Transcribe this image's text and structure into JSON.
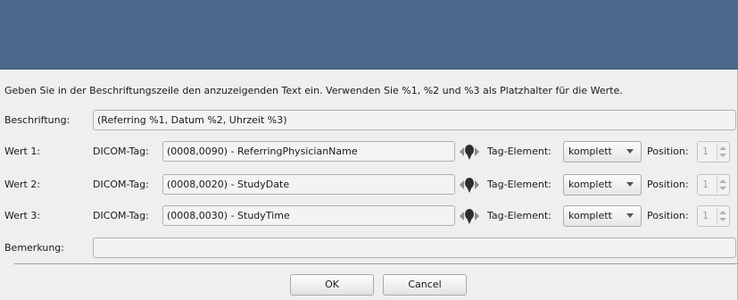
{
  "instructions": "Geben Sie in der Beschriftungszeile den anzuzeigenden Text ein. Verwenden Sie %1, %2 und %3 als Platzhalter für die Werte.",
  "caption": {
    "label": "Beschriftung:",
    "value": "(Referring %1, Datum %2, Uhrzeit %3)"
  },
  "labels": {
    "dicom_tag": "DICOM-Tag:",
    "tag_element": "Tag-Element:",
    "position": "Position:"
  },
  "rows": [
    {
      "label": "Wert 1:",
      "tag_value": "(0008,0090) - ReferringPhysicianName",
      "element": "komplett",
      "position": "1"
    },
    {
      "label": "Wert 2:",
      "tag_value": "(0008,0020) - StudyDate",
      "element": "komplett",
      "position": "1"
    },
    {
      "label": "Wert 3:",
      "tag_value": "(0008,0030) - StudyTime",
      "element": "komplett",
      "position": "1"
    }
  ],
  "remark": {
    "label": "Bemerkung:",
    "value": ""
  },
  "buttons": {
    "ok": "OK",
    "cancel": "Cancel"
  },
  "colors": {
    "titlebar": "#4a6889",
    "dialog_background": "#efefef"
  },
  "icons": {
    "tag_picker": "pipette-picker-icon",
    "dropdown": "chevron-down-icon",
    "spin": "spin-up-down-icon"
  }
}
